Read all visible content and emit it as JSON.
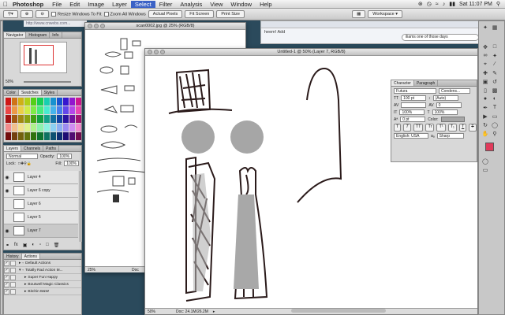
{
  "menubar": {
    "app": "Photoshop",
    "items": [
      "File",
      "Edit",
      "Image",
      "Layer",
      "Select",
      "Filter",
      "Analysis",
      "View",
      "Window",
      "Help"
    ],
    "active_index": 4,
    "clock": "Sat 11:07 PM"
  },
  "options_bar": {
    "resize_label": "Resize Windows To Fit",
    "zoom_all_label": "Zoom All Windows",
    "actual_pixels": "Actual Pixels",
    "fit_screen": "Fit Screen",
    "print_size": "Print Size",
    "workspace": "Workspace ▾"
  },
  "navigator": {
    "tabs": [
      "Navigator",
      "Histogram",
      "Info"
    ],
    "zoom": "50%"
  },
  "color_panel": {
    "tabs": [
      "Color",
      "Swatches",
      "Styles"
    ]
  },
  "layers": {
    "tabs": [
      "Layers",
      "Channels",
      "Paths"
    ],
    "blend_mode": "Normal",
    "opacity_label": "Opacity:",
    "opacity": "100%",
    "lock_label": "Lock:",
    "fill_label": "Fill:",
    "fill": "100%",
    "items": [
      {
        "name": "Layer 4",
        "visible": true,
        "selected": false
      },
      {
        "name": "Layer 6 copy",
        "visible": true,
        "selected": false
      },
      {
        "name": "Layer 6",
        "visible": false,
        "selected": false
      },
      {
        "name": "Layer 5",
        "visible": false,
        "selected": false
      },
      {
        "name": "Layer 7",
        "visible": true,
        "selected": true
      }
    ]
  },
  "actions": {
    "tabs": [
      "History",
      "Actions"
    ],
    "items": [
      {
        "name": "Default Actions",
        "folder": true,
        "indent": 0
      },
      {
        "name": "Totally Rad Action M...",
        "folder": true,
        "indent": 0
      },
      {
        "name": "Super Fun Happy",
        "folder": false,
        "indent": 1
      },
      {
        "name": "Boutwell Magic Classics",
        "folder": false,
        "indent": 1
      },
      {
        "name": "Bitchin B&W",
        "folder": false,
        "indent": 1
      }
    ]
  },
  "browser": {
    "url": "http://www.cnwebs.com...",
    "snippet": "heem! Add",
    "search_text": "iliams one of those days"
  },
  "scan_window": {
    "title": "scan0002.jpg @ 25% (RGB/8)",
    "zoom": "25%",
    "doc": "Doc"
  },
  "main_window": {
    "title": "Untitled-1 @ 50% (Layer 7, RGB/8)",
    "zoom": "50%",
    "doc_size": "Doc: 24.1M/26.2M"
  },
  "character": {
    "tabs": [
      "Character",
      "Paragraph"
    ],
    "font": "Futura",
    "style": "Condens...",
    "size": "100 pt",
    "leading": "(Auto)",
    "tracking": "0",
    "vscale": "100%",
    "hscale": "100%",
    "baseline": "0 pt",
    "color_label": "Color:",
    "language": "English: USA",
    "aa_label": "aₐ",
    "antialias": "Sharp",
    "styles": [
      "T",
      "T",
      "TT",
      "Tr",
      "T¹",
      "T₁",
      "T",
      "T"
    ]
  },
  "colors": {
    "menu_active": "#3b62c6",
    "foreground_swatch": "#e03a5a",
    "desktop": "#2b4a5c"
  }
}
